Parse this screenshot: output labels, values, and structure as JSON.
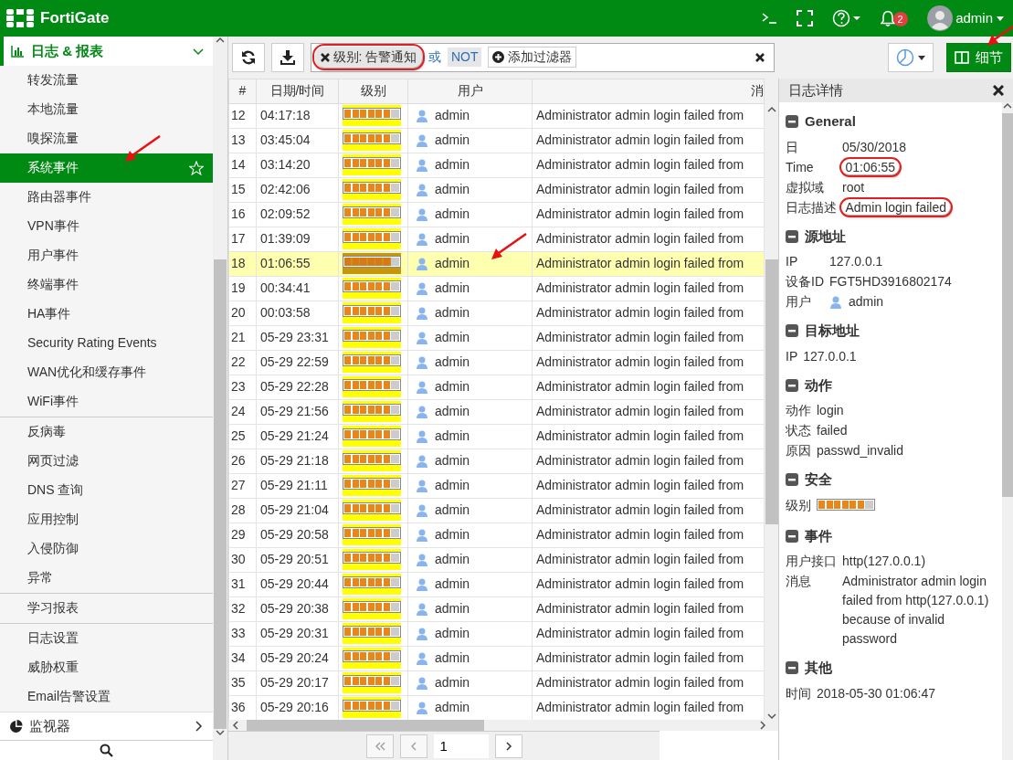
{
  "header": {
    "product": "FortiGate",
    "notifications": "2",
    "user": "admin"
  },
  "sidebar": {
    "sections": [
      {
        "label": "日志 & 报表",
        "expanded": true,
        "groups": [
          [
            {
              "label": "转发流量",
              "selected": false
            },
            {
              "label": "本地流量",
              "selected": false
            },
            {
              "label": "嗅探流量",
              "selected": false
            },
            {
              "label": "系统事件",
              "selected": true,
              "arrow": true
            },
            {
              "label": "路由器事件",
              "selected": false
            },
            {
              "label": "VPN事件",
              "selected": false
            },
            {
              "label": "用户事件",
              "selected": false
            },
            {
              "label": "终端事件",
              "selected": false
            },
            {
              "label": "HA事件",
              "selected": false
            },
            {
              "label": "Security Rating Events",
              "selected": false
            },
            {
              "label": "WAN优化和缓存事件",
              "selected": false
            },
            {
              "label": "WiFi事件",
              "selected": false
            }
          ],
          [
            {
              "label": "反病毒",
              "selected": false
            },
            {
              "label": "网页过滤",
              "selected": false
            },
            {
              "label": "DNS 查询",
              "selected": false
            },
            {
              "label": "应用控制",
              "selected": false
            },
            {
              "label": "入侵防御",
              "selected": false
            },
            {
              "label": "异常",
              "selected": false
            }
          ],
          [
            {
              "label": "学习报表",
              "selected": false
            }
          ],
          [
            {
              "label": "日志设置",
              "selected": false
            },
            {
              "label": "威胁权重",
              "selected": false
            },
            {
              "label": "Email告警设置",
              "selected": false
            }
          ]
        ]
      },
      {
        "label": "监视器",
        "expanded": false
      }
    ]
  },
  "toolbar": {
    "filters": [
      {
        "field": "级别:",
        "value": "告警通知",
        "annotated": true
      }
    ],
    "or_label": "或",
    "not_label": "NOT",
    "add_filter": "添加过滤器",
    "details_button": {
      "label": "细节",
      "selected": true,
      "arrow": true
    }
  },
  "table": {
    "columns": [
      "#",
      "日期/时间",
      "级别",
      "用户",
      "消"
    ],
    "rows": [
      {
        "n": "12",
        "time": "04:17:18",
        "level": 0.857,
        "user": "admin",
        "message": "Administrator admin login failed from",
        "selected": false
      },
      {
        "n": "13",
        "time": "03:45:04",
        "level": 0.857,
        "user": "admin",
        "message": "Administrator admin login failed from",
        "selected": false
      },
      {
        "n": "14",
        "time": "03:14:20",
        "level": 0.857,
        "user": "admin",
        "message": "Administrator admin login failed from",
        "selected": false
      },
      {
        "n": "15",
        "time": "02:42:06",
        "level": 0.857,
        "user": "admin",
        "message": "Administrator admin login failed from",
        "selected": false
      },
      {
        "n": "16",
        "time": "02:09:52",
        "level": 0.857,
        "user": "admin",
        "message": "Administrator admin login failed from",
        "selected": false
      },
      {
        "n": "17",
        "time": "01:39:09",
        "level": 0.857,
        "user": "admin",
        "message": "Administrator admin login failed from",
        "selected": false
      },
      {
        "n": "18",
        "time": "01:06:55",
        "level": 0.857,
        "user": "admin",
        "message": "Administrator admin login failed from",
        "selected": true,
        "arrow": true
      },
      {
        "n": "19",
        "time": "00:34:41",
        "level": 0.857,
        "user": "admin",
        "message": "Administrator admin login failed from",
        "selected": false
      },
      {
        "n": "20",
        "time": "00:03:58",
        "level": 0.857,
        "user": "admin",
        "message": "Administrator admin login failed from",
        "selected": false
      },
      {
        "n": "21",
        "time": "05-29 23:31",
        "level": 0.857,
        "user": "admin",
        "message": "Administrator admin login failed from",
        "selected": false
      },
      {
        "n": "22",
        "time": "05-29 22:59",
        "level": 0.857,
        "user": "admin",
        "message": "Administrator admin login failed from",
        "selected": false
      },
      {
        "n": "23",
        "time": "05-29 22:28",
        "level": 0.857,
        "user": "admin",
        "message": "Administrator admin login failed from",
        "selected": false
      },
      {
        "n": "24",
        "time": "05-29 21:56",
        "level": 0.857,
        "user": "admin",
        "message": "Administrator admin login failed from",
        "selected": false
      },
      {
        "n": "25",
        "time": "05-29 21:24",
        "level": 0.857,
        "user": "admin",
        "message": "Administrator admin login failed from",
        "selected": false
      },
      {
        "n": "26",
        "time": "05-29 21:18",
        "level": 0.857,
        "user": "admin",
        "message": "Administrator admin login failed from",
        "selected": false
      },
      {
        "n": "27",
        "time": "05-29 21:11",
        "level": 0.857,
        "user": "admin",
        "message": "Administrator admin login failed from",
        "selected": false
      },
      {
        "n": "28",
        "time": "05-29 21:04",
        "level": 0.857,
        "user": "admin",
        "message": "Administrator admin login failed from",
        "selected": false
      },
      {
        "n": "29",
        "time": "05-29 20:58",
        "level": 0.857,
        "user": "admin",
        "message": "Administrator admin login failed from",
        "selected": false
      },
      {
        "n": "30",
        "time": "05-29 20:51",
        "level": 0.857,
        "user": "admin",
        "message": "Administrator admin login failed from",
        "selected": false
      },
      {
        "n": "31",
        "time": "05-29 20:44",
        "level": 0.857,
        "user": "admin",
        "message": "Administrator admin login failed from",
        "selected": false
      },
      {
        "n": "32",
        "time": "05-29 20:38",
        "level": 0.857,
        "user": "admin",
        "message": "Administrator admin login failed from",
        "selected": false
      },
      {
        "n": "33",
        "time": "05-29 20:31",
        "level": 0.857,
        "user": "admin",
        "message": "Administrator admin login failed from",
        "selected": false
      },
      {
        "n": "34",
        "time": "05-29 20:24",
        "level": 0.857,
        "user": "admin",
        "message": "Administrator admin login failed from",
        "selected": false
      },
      {
        "n": "35",
        "time": "05-29 20:17",
        "level": 0.857,
        "user": "admin",
        "message": "Administrator admin login failed from",
        "selected": false
      },
      {
        "n": "36",
        "time": "05-29 20:16",
        "level": 0.857,
        "user": "admin",
        "message": "Administrator admin login failed from",
        "selected": false
      }
    ]
  },
  "pagination": {
    "page": "1"
  },
  "details": {
    "title": "日志详情",
    "sections": [
      {
        "title": "General",
        "fields": [
          {
            "kind": "text",
            "label": "日",
            "value": "05/30/2018"
          },
          {
            "kind": "text",
            "label": "Time",
            "value": "01:06:55",
            "annotated": true
          },
          {
            "kind": "text",
            "label": "虚拟域",
            "value": "root"
          },
          {
            "kind": "text",
            "label": "日志描述",
            "value": "Admin login failed",
            "annotated": true
          }
        ]
      },
      {
        "title": "源地址",
        "fields": [
          {
            "kind": "text",
            "label": "IP",
            "value": "127.0.0.1"
          },
          {
            "kind": "text",
            "label": "设备ID",
            "value": "FGT5HD3916802174"
          },
          {
            "kind": "user",
            "label": "用户",
            "value": "admin"
          }
        ]
      },
      {
        "title": "目标地址",
        "fields": [
          {
            "kind": "text",
            "label": "IP",
            "value": "127.0.0.1"
          }
        ]
      },
      {
        "title": "动作",
        "fields": [
          {
            "kind": "text",
            "label": "动作",
            "value": "login"
          },
          {
            "kind": "text",
            "label": "状态",
            "value": "failed"
          },
          {
            "kind": "text",
            "label": "原因",
            "value": "passwd_invalid"
          }
        ]
      },
      {
        "title": "安全",
        "fields": [
          {
            "kind": "level",
            "label": "级别",
            "level": 0.857
          }
        ]
      },
      {
        "title": "事件",
        "fields": [
          {
            "kind": "text",
            "label": "用户接口",
            "value": "http(127.0.0.1)"
          },
          {
            "kind": "text",
            "label": "消息",
            "value": "Administrator admin login failed from http(127.0.0.1) because of invalid password"
          }
        ]
      },
      {
        "title": "其他",
        "fields": [
          {
            "kind": "text",
            "label": "时间",
            "value": "2018-05-30 01:06:47"
          }
        ]
      }
    ]
  }
}
